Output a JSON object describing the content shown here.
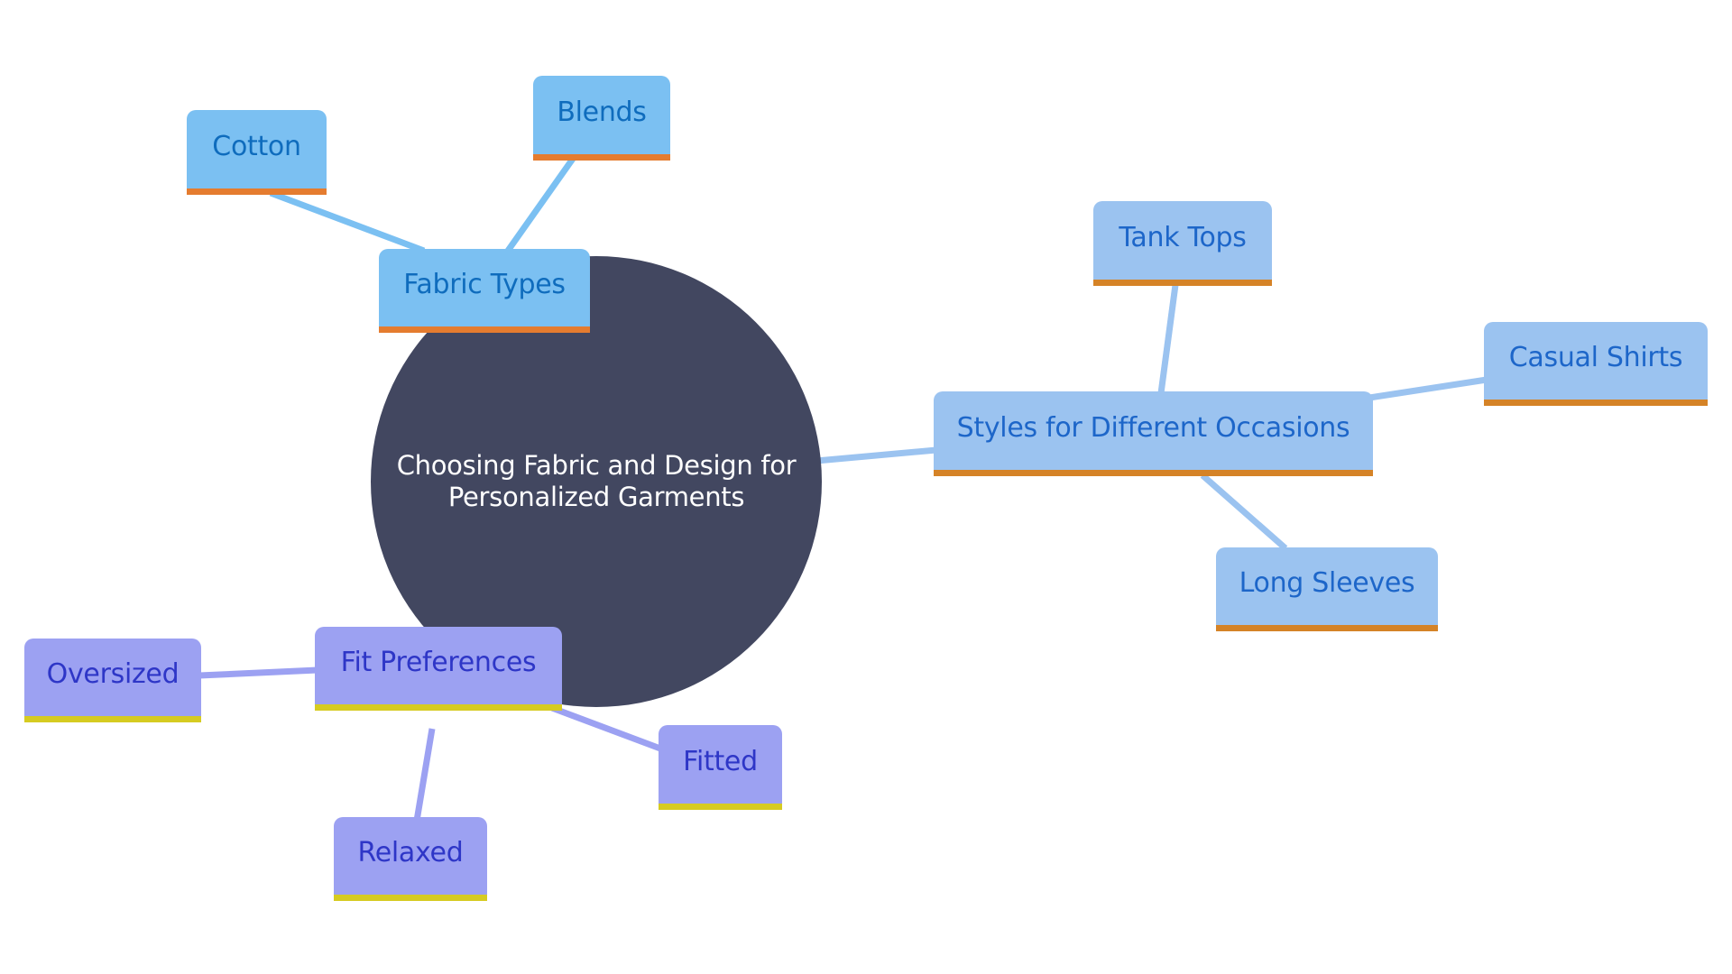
{
  "diagram": {
    "type": "mind-map",
    "root": {
      "label_line1": "Choosing Fabric and Design for",
      "label_line2": "Personalized Garments",
      "color": "#424760"
    },
    "branches": [
      {
        "id": "fabric",
        "label": "Fabric Types",
        "fill": "#7bc0f2",
        "text_color": "#0f6cbd",
        "accent": "#e57c2f",
        "children": [
          {
            "label": "Cotton"
          },
          {
            "label": "Blends"
          }
        ]
      },
      {
        "id": "styles",
        "label": "Styles for Different Occasions",
        "fill": "#9bc3f0",
        "text_color": "#1d66c9",
        "accent": "#d58327",
        "children": [
          {
            "label": "Tank Tops"
          },
          {
            "label": "Casual Shirts"
          },
          {
            "label": "Long Sleeves"
          }
        ]
      },
      {
        "id": "fit",
        "label": "Fit Preferences",
        "fill": "#9ca1f2",
        "text_color": "#2e36c7",
        "accent": "#d6cb21",
        "children": [
          {
            "label": "Oversized"
          },
          {
            "label": "Fitted"
          },
          {
            "label": "Relaxed"
          }
        ]
      }
    ],
    "edge_colors": {
      "fabric": "#7bc0f2",
      "styles": "#9bc3f0",
      "fit": "#9ca1f2"
    }
  }
}
